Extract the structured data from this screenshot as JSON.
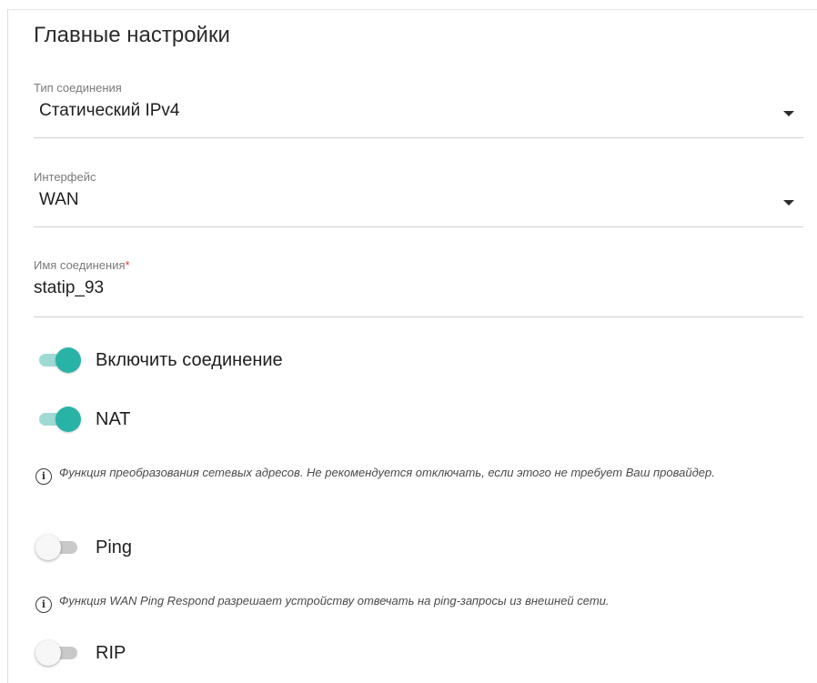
{
  "section": {
    "title": "Главные настройки"
  },
  "connection_type": {
    "label": "Тип соединения",
    "value": "Статический IPv4"
  },
  "interface": {
    "label": "Интерфейс",
    "value": "WAN"
  },
  "connection_name": {
    "label": "Имя соединения",
    "required_mark": "*",
    "value": "statip_93"
  },
  "toggles": {
    "enable": {
      "label": "Включить соединение",
      "state": "on"
    },
    "nat": {
      "label": "NAT",
      "state": "on"
    },
    "ping": {
      "label": "Ping",
      "state": "off"
    },
    "rip": {
      "label": "RIP",
      "state": "off"
    }
  },
  "info": {
    "icon": "info-circle-icon",
    "nat_text": "Функция преобразования сетевых адресов. Не рекомендуется отключать, если этого не требует Ваш провайдер.",
    "ping_text": "Функция WAN Ping Respond разрешает устройству отвечать на ping-запросы из внешней сети."
  },
  "colors": {
    "toggle_on_thumb": "#29b3a6",
    "toggle_on_track": "#9fd9d3",
    "toggle_off_track": "#c9c9c9",
    "required": "#d83a3a"
  }
}
